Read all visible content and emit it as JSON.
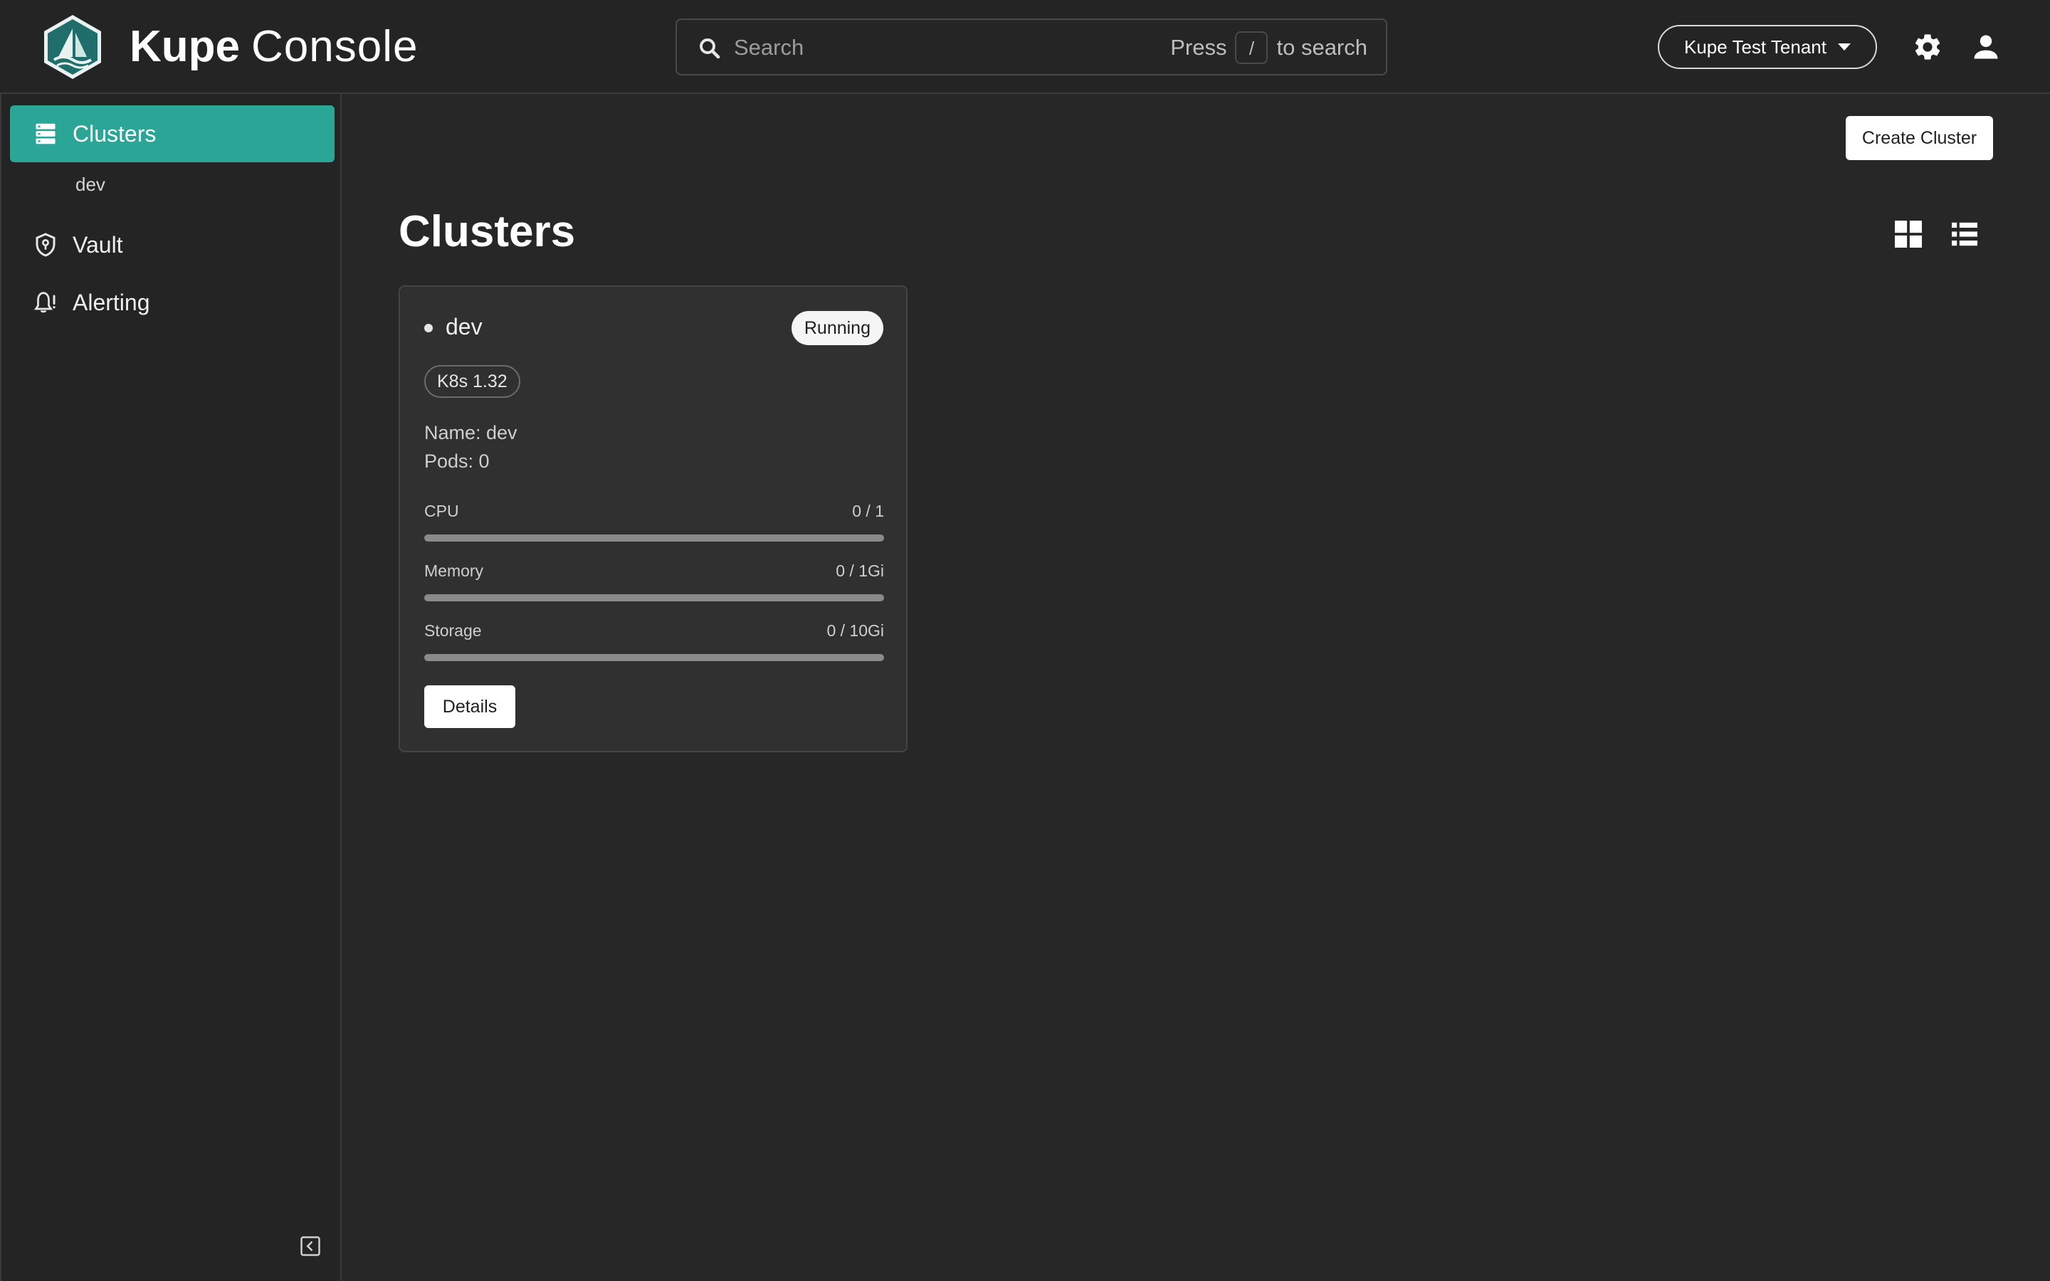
{
  "header": {
    "brand_bold": "Kupe",
    "brand_light": "Console",
    "search": {
      "placeholder": "Search",
      "hint_prefix": "Press",
      "hint_key": "/",
      "hint_suffix": "to search"
    },
    "tenant": {
      "label": "Kupe Test Tenant"
    }
  },
  "sidebar": {
    "items": [
      {
        "label": "Clusters",
        "icon": "server-stack-icon",
        "active": true
      },
      {
        "label": "Vault",
        "icon": "shield-key-icon",
        "active": false
      },
      {
        "label": "Alerting",
        "icon": "bell-alert-icon",
        "active": false
      }
    ],
    "sub_items": [
      {
        "label": "dev"
      }
    ]
  },
  "main": {
    "create_button_label": "Create Cluster",
    "title": "Clusters",
    "view_toggles": [
      "grid-view-icon",
      "list-view-icon"
    ],
    "cards": [
      {
        "name": "dev",
        "status": "Running",
        "version": "K8s 1.32",
        "meta_name": "Name: dev",
        "meta_pods": "Pods: 0",
        "resources": [
          {
            "label": "CPU",
            "value": "0 / 1",
            "fraction": 0
          },
          {
            "label": "Memory",
            "value": "0 / 1Gi",
            "fraction": 0
          },
          {
            "label": "Storage",
            "value": "0 / 10Gi",
            "fraction": 0
          }
        ],
        "details_label": "Details"
      }
    ]
  },
  "colors": {
    "accent": "#2aa596",
    "background": "#282727",
    "panel": "#252424",
    "card": "#303030"
  }
}
